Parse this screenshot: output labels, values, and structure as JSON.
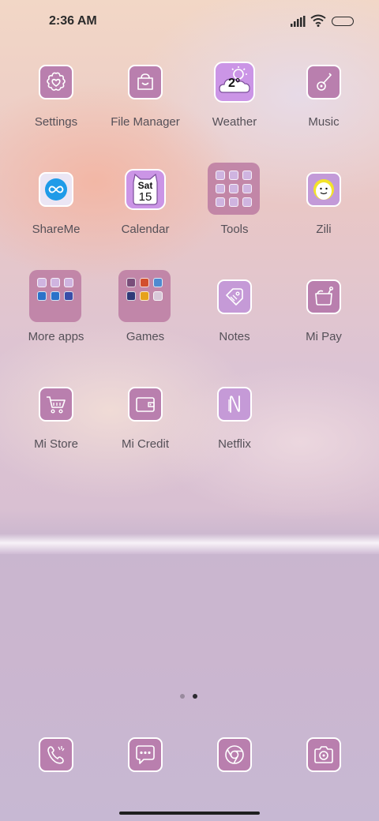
{
  "status_bar": {
    "time": "2:36 AM"
  },
  "apps": {
    "settings": "Settings",
    "file_manager": "File Manager",
    "weather": "Weather",
    "music": "Music",
    "shareme": "ShareMe",
    "calendar": "Calendar",
    "tools": "Tools",
    "zili": "Zili",
    "more_apps": "More apps",
    "games": "Games",
    "notes": "Notes",
    "mi_pay": "Mi Pay",
    "mi_store": "Mi Store",
    "mi_credit": "Mi Credit",
    "netflix": "Netflix"
  },
  "weather_icon": {
    "temp": "2°"
  },
  "calendar_icon": {
    "day": "Sat",
    "date": "15"
  },
  "page_indicator": {
    "pages": 2,
    "current": 2
  },
  "dock": [
    {
      "name": "phone-icon"
    },
    {
      "name": "messages-icon"
    },
    {
      "name": "browser-icon"
    },
    {
      "name": "camera-icon"
    }
  ],
  "colors": {
    "tile": "#b97fae",
    "tile_border": "#ffffff",
    "label": "#555058"
  }
}
